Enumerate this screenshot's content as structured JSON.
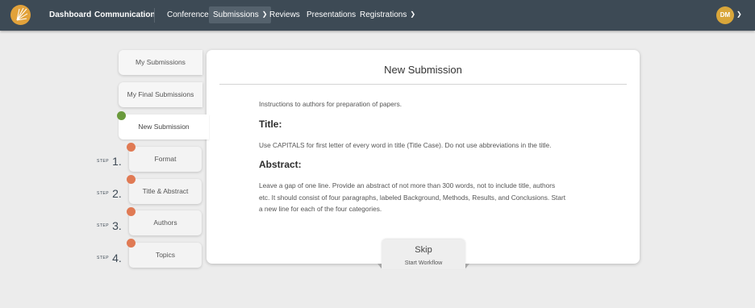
{
  "nav": {
    "links": [
      {
        "label": "Dashboard"
      },
      {
        "label": "Communication"
      },
      {
        "label": "Conference"
      },
      {
        "label": "Submissions"
      },
      {
        "label": "Reviews"
      },
      {
        "label": "Presentations"
      },
      {
        "label": "Registrations"
      }
    ],
    "avatar_initials": "DM"
  },
  "sidebar": {
    "tabs": [
      {
        "label": "My Submissions"
      },
      {
        "label": "My Final Submissions"
      },
      {
        "label": "New Submission"
      }
    ],
    "step_word": "STEP",
    "steps": [
      {
        "number": "1.",
        "label": "Format"
      },
      {
        "number": "2.",
        "label": "Title & Abstract"
      },
      {
        "number": "3.",
        "label": "Authors"
      },
      {
        "number": "4.",
        "label": "Topics"
      }
    ]
  },
  "main": {
    "title": "New Submission",
    "intro": "Instructions to authors for preparation of papers.",
    "title_heading": "Title:",
    "title_text": "Use CAPITALS for first letter of every word in title (Title Case). Do not use abbreviations in the title.",
    "abstract_heading": "Abstract:",
    "abstract_line1": "Leave a gap of one line. Provide an abstract of not more than 300 words, not to include title, authors",
    "abstract_line2": "etc. It should consist of four paragraphs, labeled Background, Methods, Results, and Conclusions. Start",
    "abstract_line3": "a new line for each of the four categories."
  },
  "skip": {
    "label": "Skip",
    "sublabel": "Start Workflow"
  },
  "colors": {
    "topbar": "#3d4a55",
    "accent_gold": "#e2a23b",
    "step_dot": "#e07a54",
    "active_dot": "#6a9a3c"
  }
}
